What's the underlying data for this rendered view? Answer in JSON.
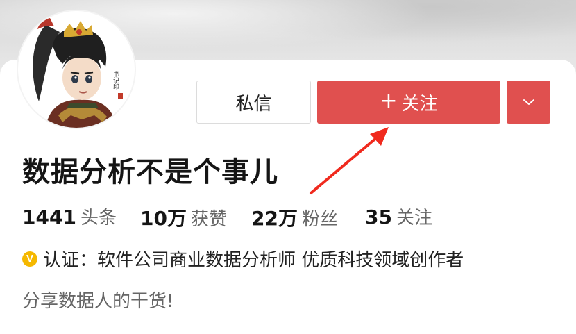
{
  "profile": {
    "name": "数据分析不是个事儿",
    "avatar": "avatar-character-illustration"
  },
  "buttons": {
    "message_label": "私信",
    "follow_plus": "+",
    "follow_label": "关注",
    "more_icon": "chevron-down-icon"
  },
  "stats": [
    {
      "value": "1441",
      "label": "头条"
    },
    {
      "value": "10万",
      "label": "获赞"
    },
    {
      "value": "22万",
      "label": "粉丝"
    },
    {
      "value": "35",
      "label": "关注"
    }
  ],
  "verification": {
    "badge": "V",
    "text": "认证：软件公司商业数据分析师 优质科技领域创作者"
  },
  "bio": "分享数据人的干货!",
  "colors": {
    "accent": "#e0504f",
    "annotation_arrow": "#f02a1e",
    "verify_badge": "#f5b800"
  }
}
